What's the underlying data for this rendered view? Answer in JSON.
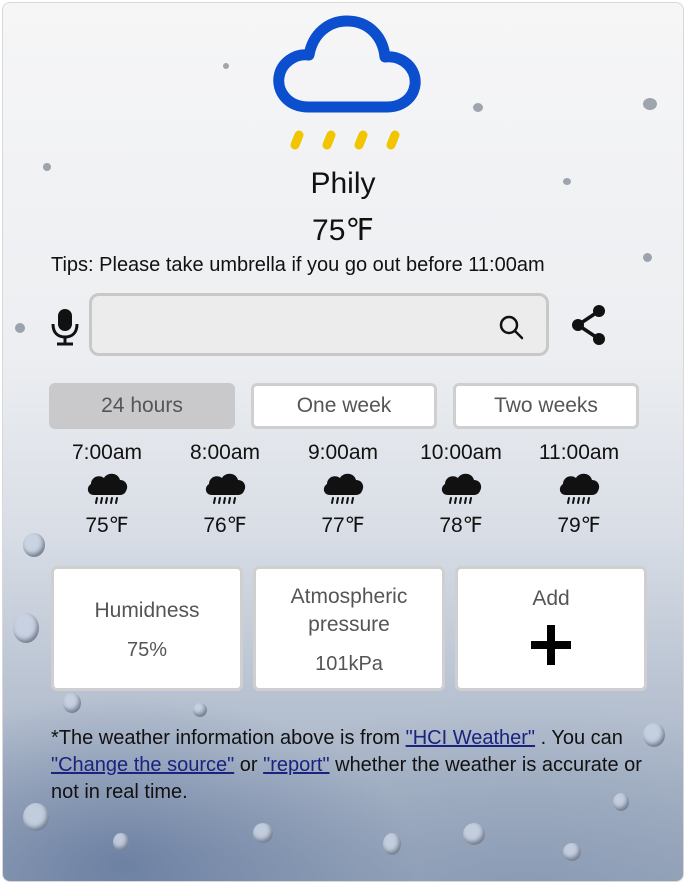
{
  "weather": {
    "city": "Phily",
    "temperature": "75℉",
    "icon": "rain-cloud-icon",
    "tip": "Tips: Please take umbrella if you go out before 11:00am"
  },
  "search": {
    "value": "",
    "placeholder": ""
  },
  "tabs": [
    {
      "label": "24 hours",
      "active": true
    },
    {
      "label": "One week",
      "active": false
    },
    {
      "label": "Two weeks",
      "active": false
    }
  ],
  "hourly": [
    {
      "time": "7:00am",
      "temp": "75℉",
      "icon": "rain-cloud-icon"
    },
    {
      "time": "8:00am",
      "temp": "76℉",
      "icon": "rain-cloud-icon"
    },
    {
      "time": "9:00am",
      "temp": "77℉",
      "icon": "rain-cloud-icon"
    },
    {
      "time": "10:00am",
      "temp": "78℉",
      "icon": "rain-cloud-icon"
    },
    {
      "time": "11:00am",
      "temp": "79℉",
      "icon": "rain-cloud-icon"
    }
  ],
  "cards": {
    "humidity": {
      "label": "Humidness",
      "value": "75%"
    },
    "pressure": {
      "label_line1": "Atmospheric",
      "label_line2": "pressure",
      "value": "101kPa"
    },
    "add": {
      "label": "Add",
      "icon": "plus-icon"
    }
  },
  "note": {
    "part1": "*The weather information above is from ",
    "link_source": "\"HCI Weather\"",
    "part2": " . You can ",
    "link_change": "\"Change the source\"",
    "part3": " or ",
    "link_report": "\"report\"",
    "part4": " whether the weather is accurate or not in real time."
  },
  "colors": {
    "cloud": "#0b4fcf",
    "rain": "#f2c500",
    "tab_active": "#c9c9cb",
    "link": "#1a237e"
  }
}
